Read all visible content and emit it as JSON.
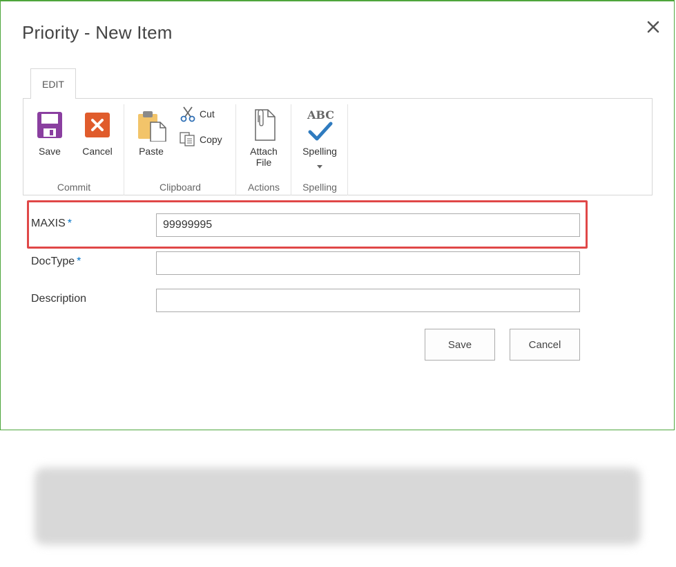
{
  "dialog": {
    "title": "Priority - New Item"
  },
  "ribbon": {
    "tab_label": "EDIT",
    "groups": {
      "commit": {
        "label": "Commit",
        "save_label": "Save",
        "cancel_label": "Cancel"
      },
      "clipboard": {
        "label": "Clipboard",
        "paste_label": "Paste",
        "cut_label": "Cut",
        "copy_label": "Copy"
      },
      "actions": {
        "label": "Actions",
        "attach_line1": "Attach",
        "attach_line2": "File"
      },
      "spelling": {
        "label": "Spelling",
        "spelling_label": "Spelling",
        "abc_text": "ABC"
      }
    }
  },
  "form": {
    "fields": [
      {
        "label": "MAXIS",
        "required": "*",
        "value": "99999995"
      },
      {
        "label": "DocType",
        "required": "*",
        "value": ""
      },
      {
        "label": "Description",
        "value": ""
      }
    ],
    "save_label": "Save",
    "cancel_label": "Cancel"
  },
  "icons": {
    "close": "close-icon",
    "save": "save-floppy-icon",
    "cancel": "cancel-x-icon",
    "paste": "paste-clipboard-icon",
    "cut": "scissors-icon",
    "copy": "copy-icon",
    "attach": "paperclip-icon",
    "spelling": "spelling-check-icon"
  },
  "colors": {
    "dialog_border": "#4ea63c",
    "highlight_border": "#e04848",
    "required_star": "#0072c6",
    "save_icon": "#8a3fa0",
    "cancel_icon": "#e05c2c",
    "paste_icon": "#f2c46a",
    "spelling_check": "#2f7bbf"
  }
}
